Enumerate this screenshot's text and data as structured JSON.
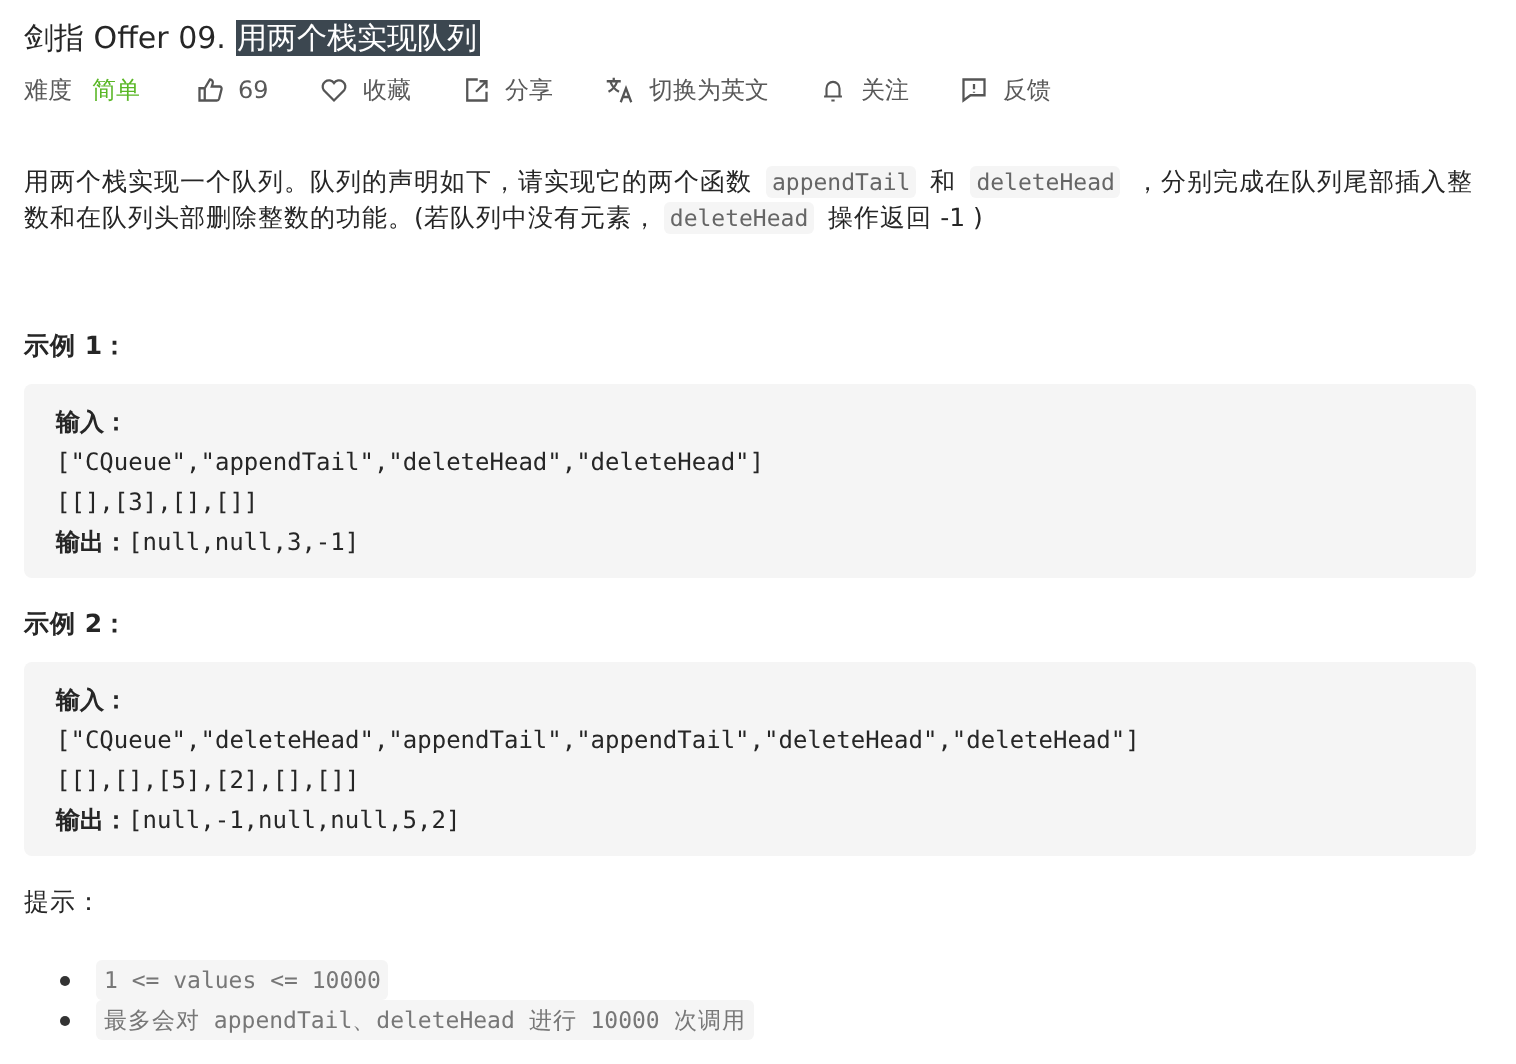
{
  "title": {
    "segments": [
      {
        "text": "剑指 Offer 09. ",
        "selected": false
      },
      {
        "text": "用两个栈实现队列",
        "selected": true
      }
    ]
  },
  "meta": [
    {
      "kind": "difficulty",
      "label": "难度",
      "value": "简单"
    },
    {
      "kind": "like",
      "label": "69"
    },
    {
      "kind": "favorite",
      "label": "收藏"
    },
    {
      "kind": "share",
      "label": "分享"
    },
    {
      "kind": "translate",
      "label": "切换为英文"
    },
    {
      "kind": "follow",
      "label": "关注"
    },
    {
      "kind": "feedback",
      "label": "反馈"
    }
  ],
  "description": [
    {
      "kind": "text",
      "text": "用两个栈实现一个队列。队列的声明如下，请实现它的两个函数 "
    },
    {
      "kind": "code",
      "text": "appendTail"
    },
    {
      "kind": "text",
      "text": " 和 "
    },
    {
      "kind": "code",
      "text": "deleteHead"
    },
    {
      "kind": "text",
      "text": " ，分别完成在队列尾部插入整数和在队列头部删除整数的功能。(若队列中没有元素，"
    },
    {
      "kind": "code",
      "text": "deleteHead"
    },
    {
      "kind": "text",
      "text": " 操作返回 -1 )"
    }
  ],
  "examples": [
    {
      "heading": "示例 1：",
      "input_label": "输入：",
      "lines": [
        "[\"CQueue\",\"appendTail\",\"deleteHead\",\"deleteHead\"]",
        "[[],[3],[],[]]"
      ],
      "output_label": "输出：",
      "output": "[null,null,3,-1]"
    },
    {
      "heading": "示例 2：",
      "input_label": "输入：",
      "lines": [
        "[\"CQueue\",\"deleteHead\",\"appendTail\",\"appendTail\",\"deleteHead\",\"deleteHead\"]",
        "[[],[],[5],[2],[],[]]"
      ],
      "output_label": "输出：",
      "output": "[null,-1,null,null,5,2]"
    }
  ],
  "hints": {
    "heading": "提示：",
    "items": [
      "1 <= values <= 10000",
      "最多会对 appendTail、deleteHead 进行 10000 次调用"
    ]
  }
}
